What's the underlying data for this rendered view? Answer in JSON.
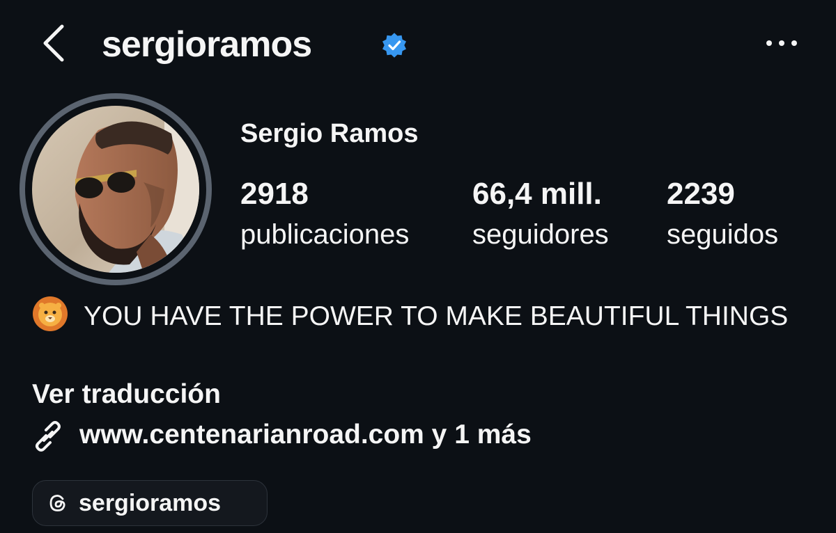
{
  "header": {
    "username": "sergioramos",
    "back_icon": "chevron-left-icon",
    "verified_icon": "verified-badge-icon",
    "more_icon": "more-horizontal-icon",
    "verified_color": "#3797f0"
  },
  "profile": {
    "full_name": "Sergio Ramos",
    "stats": [
      {
        "value": "2918",
        "label": "publicaciones"
      },
      {
        "value": "66,4 mill.",
        "label": "seguidores"
      },
      {
        "value": "2239",
        "label": "seguidos"
      }
    ],
    "bio_emoji": "lion-face-emoji",
    "bio": "YOU HAVE THE POWER TO MAKE BEAUTIFUL THINGS",
    "translate_label": "Ver traducción",
    "link_icon": "link-icon",
    "link_text": "www.centenarianroad.com y 1 más",
    "threads_icon": "threads-icon",
    "threads_handle": "sergioramos"
  },
  "colors": {
    "background": "#0c1015",
    "text": "#f5f5f5",
    "avatar_ring": "#5b6470"
  }
}
